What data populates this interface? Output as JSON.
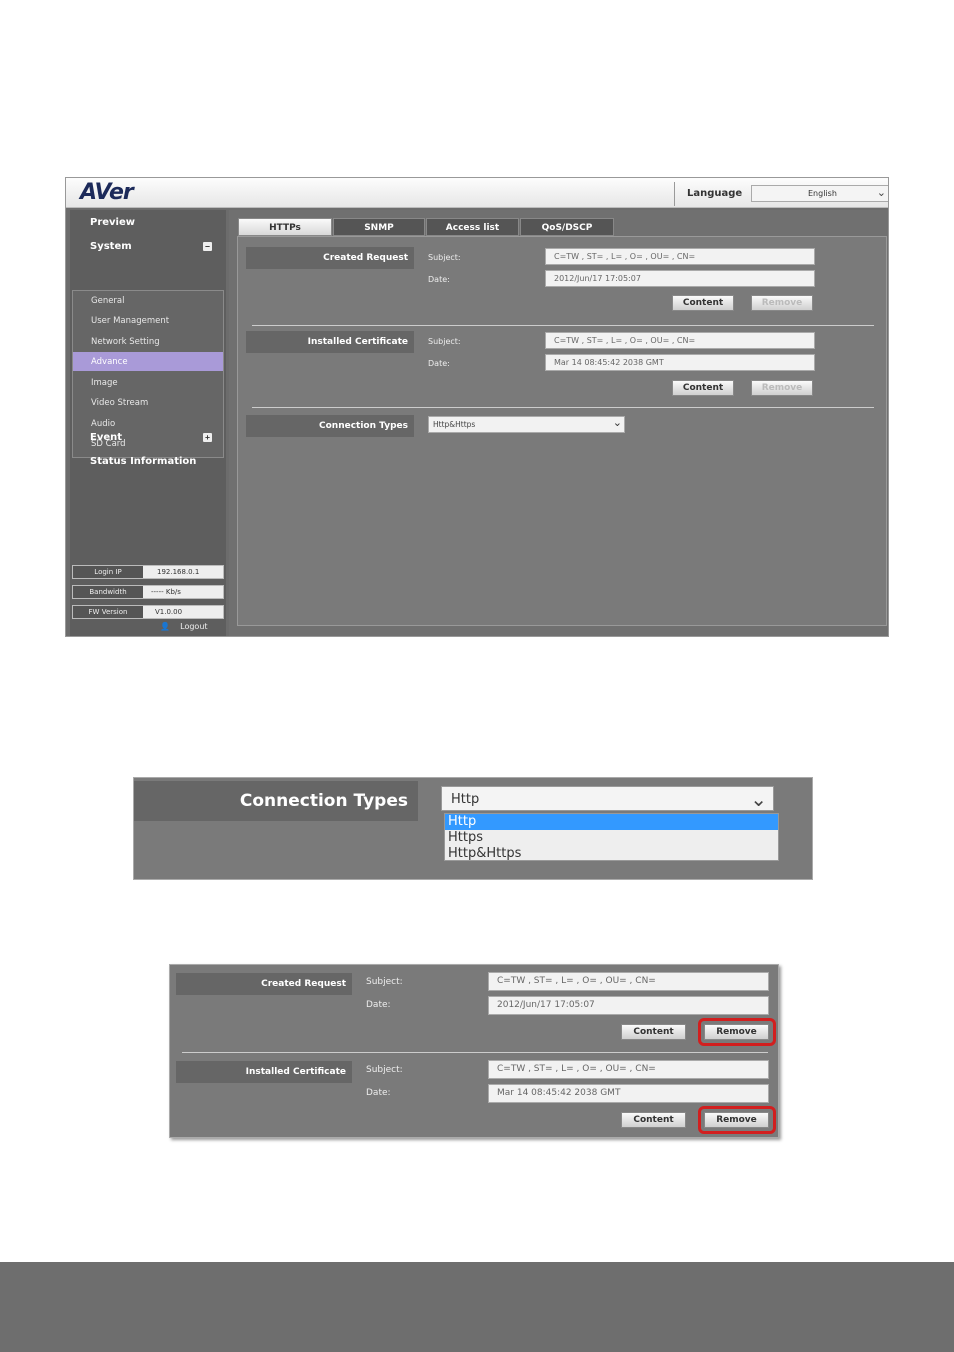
{
  "app": {
    "logo": "AVer",
    "language_label": "Language",
    "language_value": "English"
  },
  "sidebar": {
    "preview": "Preview",
    "system": "System",
    "system_items": [
      "General",
      "User Management",
      "Network Setting",
      "Advance",
      "Image",
      "Video Stream",
      "Audio",
      "SD Card"
    ],
    "active_item": "Advance",
    "event": "Event",
    "status": "Status Information",
    "login_ip_label": "Login IP",
    "login_ip_value": "192.168.0.1",
    "bandwidth_label": "Bandwidth",
    "bandwidth_value": "----- Kb/s",
    "fw_label": "FW Version",
    "fw_value": "V1.0.00",
    "logout": "Logout"
  },
  "tabs": [
    "HTTPs",
    "SNMP",
    "Access list",
    "QoS/DSCP"
  ],
  "active_tab": "HTTPs",
  "https": {
    "created_request": {
      "title": "Created Request",
      "subject_label": "Subject:",
      "subject_value": "C=TW , ST= , L= , O= , OU= , CN=",
      "date_label": "Date:",
      "date_value": "2012/Jun/17 17:05:07",
      "content_btn": "Content",
      "remove_btn": "Remove"
    },
    "installed_certificate": {
      "title": "Installed Certificate",
      "subject_label": "Subject:",
      "subject_value": "C=TW , ST= , L= , O= , OU= , CN=",
      "date_label": "Date:",
      "date_value": "Mar 14 08:45:42 2038 GMT",
      "content_btn": "Content",
      "remove_btn": "Remove"
    },
    "connection_types": {
      "title": "Connection Types",
      "value": "Http&Https"
    }
  },
  "dropdown_zoom": {
    "title": "Connection Types",
    "current": "Http",
    "options": [
      "Http",
      "Https",
      "Http&Https"
    ],
    "highlighted": "Http"
  }
}
